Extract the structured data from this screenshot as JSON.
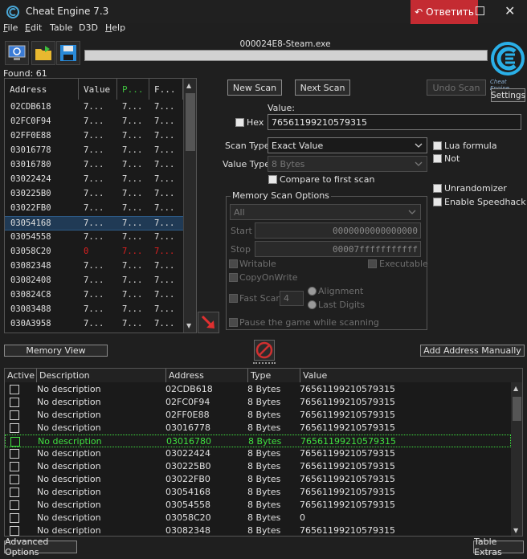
{
  "window": {
    "title": "Cheat Engine 7.3",
    "reply_label": "Ответить"
  },
  "menu": [
    {
      "label": "File",
      "u": "F",
      "rest": "ile"
    },
    {
      "label": "Edit",
      "u": "E",
      "rest": "dit"
    },
    {
      "label": "Table",
      "u": "",
      "rest": "Table"
    },
    {
      "label": "D3D",
      "u": "",
      "rest": "D3D"
    },
    {
      "label": "Help",
      "u": "H",
      "rest": "elp"
    }
  ],
  "toolbar": {
    "process_name": "000024E8-Steam.exe",
    "settings_label": "Settings",
    "logo_caption": "Cheat Engine"
  },
  "found": "Found: 61",
  "found_list": {
    "headers": [
      "Address",
      "Value",
      "P...",
      "F..."
    ],
    "rows": [
      {
        "address": "02CDB618",
        "value": "7...",
        "p": "7...",
        "f": "7..."
      },
      {
        "address": "02FC0F94",
        "value": "7...",
        "p": "7...",
        "f": "7..."
      },
      {
        "address": "02FF0E88",
        "value": "7...",
        "p": "7...",
        "f": "7..."
      },
      {
        "address": "03016778",
        "value": "7...",
        "p": "7...",
        "f": "7..."
      },
      {
        "address": "03016780",
        "value": "7...",
        "p": "7...",
        "f": "7..."
      },
      {
        "address": "03022424",
        "value": "7...",
        "p": "7...",
        "f": "7..."
      },
      {
        "address": "030225B0",
        "value": "7...",
        "p": "7...",
        "f": "7..."
      },
      {
        "address": "03022FB0",
        "value": "7...",
        "p": "7...",
        "f": "7..."
      },
      {
        "address": "03054168",
        "value": "7...",
        "p": "7...",
        "f": "7..."
      },
      {
        "address": "03054558",
        "value": "7...",
        "p": "7...",
        "f": "7..."
      },
      {
        "address": "03058C20",
        "value": "0",
        "p": "7...",
        "f": "7..."
      },
      {
        "address": "03082348",
        "value": "7...",
        "p": "7...",
        "f": "7..."
      },
      {
        "address": "03082408",
        "value": "7...",
        "p": "7...",
        "f": "7..."
      },
      {
        "address": "030824C8",
        "value": "7...",
        "p": "7...",
        "f": "7..."
      },
      {
        "address": "03083488",
        "value": "7...",
        "p": "7...",
        "f": "7..."
      },
      {
        "address": "030A3958",
        "value": "7...",
        "p": "7...",
        "f": "7..."
      }
    ]
  },
  "scan": {
    "new_scan": "New Scan",
    "next_scan": "Next Scan",
    "undo_scan": "Undo Scan",
    "value_label": "Value:",
    "hex_label": "Hex",
    "value": "76561199210579315",
    "scan_type_label": "Scan Type",
    "scan_type": "Exact Value",
    "value_type_label": "Value Type",
    "value_type": "8 Bytes",
    "compare_first": "Compare to first scan",
    "lua_formula": "Lua formula",
    "not": "Not",
    "unrandomizer": "Unrandomizer",
    "speedhack": "Enable Speedhack"
  },
  "memory": {
    "title": "Memory Scan Options",
    "region": "All",
    "start_label": "Start",
    "start": "0000000000000000",
    "stop_label": "Stop",
    "stop": "00007fffffffffff",
    "writable": "Writable",
    "executable": "Executable",
    "copy_on_write": "CopyOnWrite",
    "fast_scan": "Fast Scan",
    "fast_scan_value": "4",
    "alignment": "Alignment",
    "last_digits": "Last Digits",
    "pause": "Pause the game while scanning"
  },
  "buttons": {
    "memory_view": "Memory View",
    "add_address": "Add Address Manually",
    "advanced_options": "Advanced Options",
    "table_extras": "Table Extras"
  },
  "address_list": {
    "headers": [
      "Active",
      "Description",
      "Address",
      "Type",
      "Value"
    ],
    "rows": [
      {
        "desc": "No description",
        "address": "02CDB618",
        "type": "8 Bytes",
        "value": "76561199210579315"
      },
      {
        "desc": "No description",
        "address": "02FC0F94",
        "type": "8 Bytes",
        "value": "76561199210579315"
      },
      {
        "desc": "No description",
        "address": "02FF0E88",
        "type": "8 Bytes",
        "value": "76561199210579315"
      },
      {
        "desc": "No description",
        "address": "03016778",
        "type": "8 Bytes",
        "value": "76561199210579315"
      },
      {
        "desc": "No description",
        "address": "03016780",
        "type": "8 Bytes",
        "value": "76561199210579315"
      },
      {
        "desc": "No description",
        "address": "03022424",
        "type": "8 Bytes",
        "value": "76561199210579315"
      },
      {
        "desc": "No description",
        "address": "030225B0",
        "type": "8 Bytes",
        "value": "76561199210579315"
      },
      {
        "desc": "No description",
        "address": "03022FB0",
        "type": "8 Bytes",
        "value": "76561199210579315"
      },
      {
        "desc": "No description",
        "address": "03054168",
        "type": "8 Bytes",
        "value": "76561199210579315"
      },
      {
        "desc": "No description",
        "address": "03054558",
        "type": "8 Bytes",
        "value": "76561199210579315"
      },
      {
        "desc": "No description",
        "address": "03058C20",
        "type": "8 Bytes",
        "value": "0"
      },
      {
        "desc": "No description",
        "address": "03082348",
        "type": "8 Bytes",
        "value": "76561199210579315"
      }
    ]
  }
}
